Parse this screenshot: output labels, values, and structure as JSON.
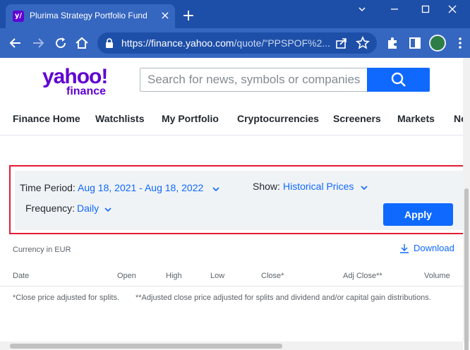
{
  "browser": {
    "tab_title": "Plurima Strategy Portfolio Fund (",
    "favicon_text": "y/",
    "url_host": "https://finance.yahoo.com",
    "url_path": "/quote/\"PPSPOF%2..."
  },
  "header": {
    "logo_yahoo": "yahoo!",
    "logo_finance": "finance",
    "search_placeholder": "Search for news, symbols or companies"
  },
  "nav": {
    "items": [
      "Finance Home",
      "Watchlists",
      "My Portfolio",
      "Cryptocurrencies",
      "Screeners",
      "Markets",
      "Ne"
    ]
  },
  "filters": {
    "time_period_label": "Time Period:",
    "time_period_value": "Aug 18, 2021 - Aug 18, 2022",
    "show_label": "Show:",
    "show_value": "Historical Prices",
    "frequency_label": "Frequency:",
    "frequency_value": "Daily",
    "apply_label": "Apply"
  },
  "table": {
    "currency": "Currency in EUR",
    "download_label": "Download",
    "columns": [
      "Date",
      "Open",
      "High",
      "Low",
      "Close*",
      "Adj Close**",
      "Volume"
    ],
    "note_close": "*Close price adjusted for splits.",
    "note_adj": "**Adjusted close price adjusted for splits and dividend and/or capital gain distributions."
  },
  "colors": {
    "chrome": "#1e4fa8",
    "brand_purple": "#6001d2",
    "accent_blue": "#0f69ff",
    "highlight_red": "#e41c34"
  },
  "icons": [
    "back-icon",
    "forward-icon",
    "reload-icon",
    "home-icon",
    "lock-icon",
    "share-icon",
    "star-icon",
    "extensions-icon",
    "sidepanel-icon",
    "menu-icon",
    "search-icon",
    "chevron-down-icon",
    "download-icon"
  ]
}
